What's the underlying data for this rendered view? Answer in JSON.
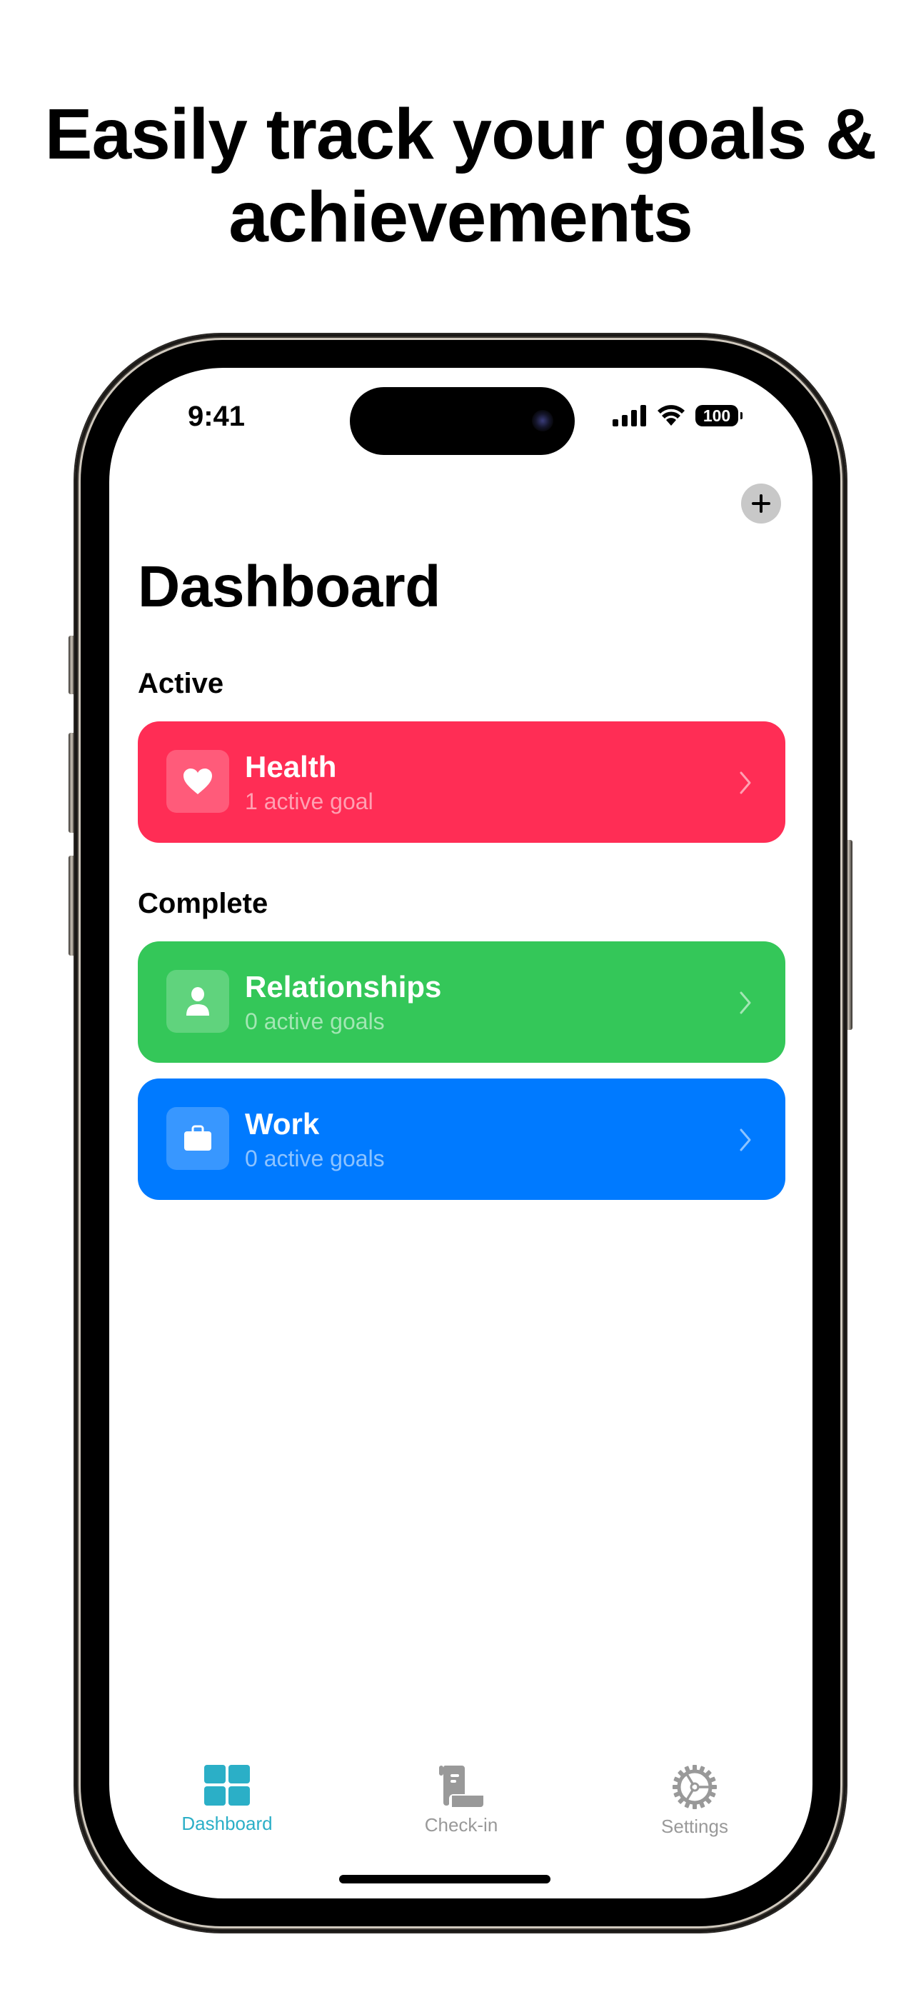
{
  "headline": {
    "line1": "Easily track your goals &",
    "line2": "achievements"
  },
  "status_bar": {
    "time": "9:41",
    "battery": "100",
    "icons": [
      "signal-icon",
      "wifi-icon",
      "battery-icon"
    ]
  },
  "toolbar": {
    "add_button_label": "+",
    "add_icon": "plus-icon"
  },
  "page": {
    "title": "Dashboard"
  },
  "sections": [
    {
      "title": "Active",
      "cards": [
        {
          "name": "Health",
          "subtitle": "1 active goal",
          "icon": "heart-icon",
          "color": "#FF2D55"
        }
      ]
    },
    {
      "title": "Complete",
      "cards": [
        {
          "name": "Relationships",
          "subtitle": "0 active goals",
          "icon": "person-icon",
          "color": "#34C759"
        },
        {
          "name": "Work",
          "subtitle": "0 active goals",
          "icon": "briefcase-icon",
          "color": "#007AFF"
        }
      ]
    }
  ],
  "tabbar": {
    "active_color": "#2BAFC7",
    "inactive_color": "#999999",
    "items": [
      {
        "label": "Dashboard",
        "icon": "grid-icon",
        "selected": true
      },
      {
        "label": "Check-in",
        "icon": "scroll-icon",
        "selected": false
      },
      {
        "label": "Settings",
        "icon": "gear-icon",
        "selected": false
      }
    ]
  }
}
